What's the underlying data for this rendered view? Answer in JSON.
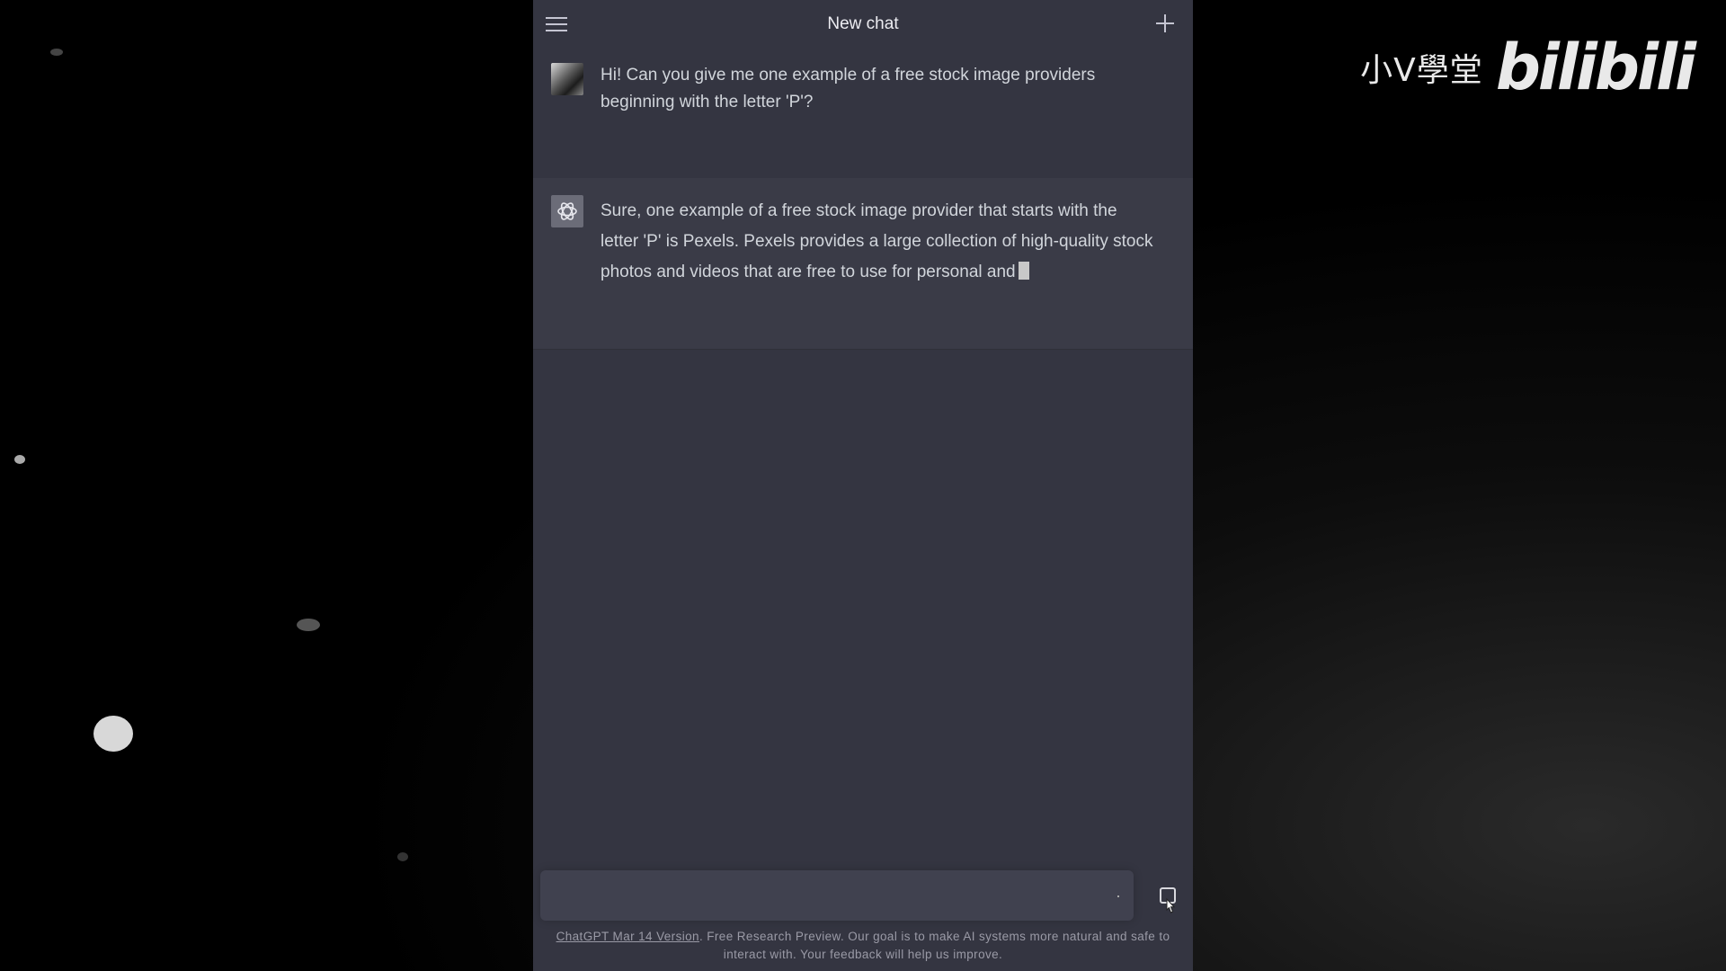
{
  "watermark": {
    "channel": "小V學堂",
    "logo": "bilibili"
  },
  "header": {
    "title": "New chat"
  },
  "messages": [
    {
      "role": "user",
      "text": "Hi! Can you give me one example of a free stock image providers beginning with the letter 'P'?"
    },
    {
      "role": "assistant",
      "text": "Sure, one example of a free stock image provider that starts with the letter 'P' is Pexels. Pexels provides a large collection of high-quality stock photos and videos that are free to use for personal and"
    }
  ],
  "composer": {
    "value": ""
  },
  "footer": {
    "version_link": "ChatGPT Mar 14 Version",
    "text": ". Free Research Preview. Our goal is to make AI systems more natural and safe to interact with. Your feedback will help us improve."
  }
}
